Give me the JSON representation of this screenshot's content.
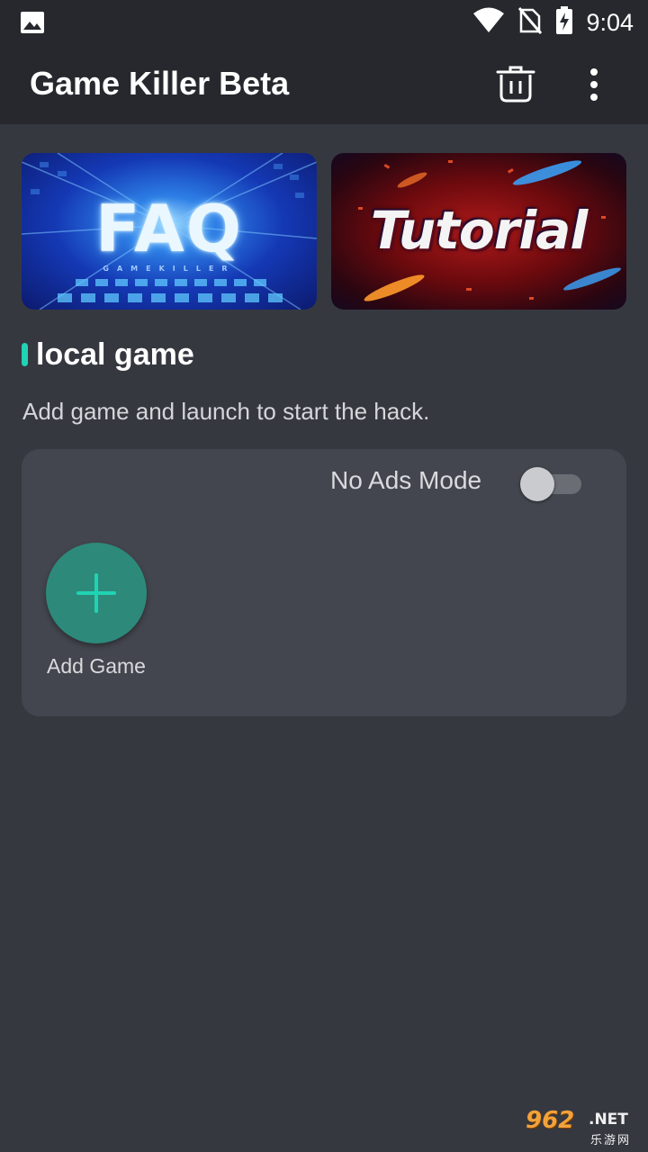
{
  "status_bar": {
    "time": "9:04",
    "icons": [
      "image-icon",
      "wifi-icon",
      "no-sim-icon",
      "battery-charging-icon"
    ]
  },
  "app_bar": {
    "title": "Game Killer Beta",
    "actions": [
      "trash-icon",
      "more-vert-icon"
    ]
  },
  "banners": {
    "faq": {
      "title": "FAQ",
      "subtitle": "GAMEKILLER"
    },
    "tutorial": {
      "title": "Tutorial"
    }
  },
  "section": {
    "title": "local game",
    "description": "Add game and launch to start the hack."
  },
  "card": {
    "no_ads_label": "No Ads Mode",
    "no_ads_enabled": false,
    "add_game_label": "Add Game"
  },
  "watermark": {
    "main": "962",
    "net": ".NET",
    "sub": "乐游网"
  },
  "colors": {
    "background": "#363840",
    "app_bar": "#26282d",
    "card": "#43464e",
    "accent": "#20d3b3",
    "add_button": "#2d8a7b"
  }
}
